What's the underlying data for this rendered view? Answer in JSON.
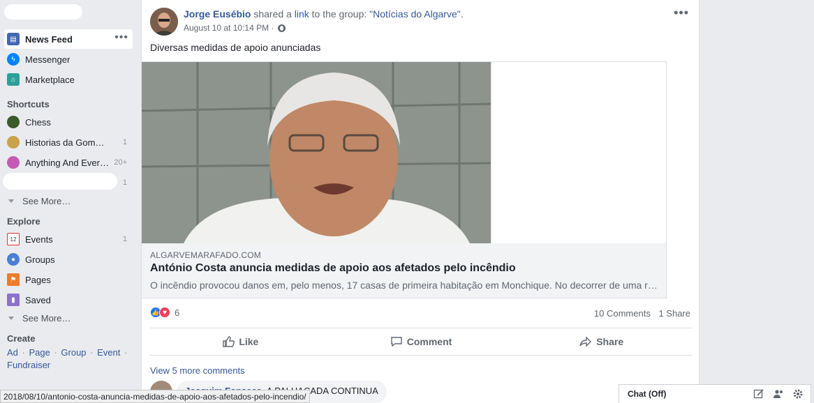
{
  "sidebar": {
    "main": [
      {
        "label": "News Feed",
        "icon": "news-feed-icon",
        "color": "#4267b2"
      },
      {
        "label": "Messenger",
        "icon": "messenger-icon",
        "color": "#0084ff"
      },
      {
        "label": "Marketplace",
        "icon": "marketplace-icon",
        "color": "#2aa198"
      }
    ],
    "shortcuts_title": "Shortcuts",
    "shortcuts": [
      {
        "label": "Chess",
        "count": ""
      },
      {
        "label": "Historias da Gomei…",
        "count": "1"
      },
      {
        "label": "Anything And Ever…",
        "count": "20+"
      },
      {
        "label": "",
        "count": "1"
      }
    ],
    "see_more": "See More…",
    "explore_title": "Explore",
    "explore": [
      {
        "label": "Events",
        "count": "1",
        "icon": "calendar-icon"
      },
      {
        "label": "Groups",
        "count": "",
        "icon": "groups-icon"
      },
      {
        "label": "Pages",
        "count": "",
        "icon": "pages-flag-icon"
      },
      {
        "label": "Saved",
        "count": "",
        "icon": "saved-bookmark-icon"
      }
    ],
    "see_more_2": "See More…",
    "create_title": "Create",
    "create_links": [
      "Ad",
      "Page",
      "Group",
      "Event",
      "Fundraiser"
    ]
  },
  "post": {
    "author": "Jorge Eusébio",
    "action_pre": " shared a ",
    "action_link": "link",
    "action_post": " to the group: ",
    "group": "\"Notícias do Algarve\"",
    "period": ".",
    "time": "August 10 at 10:14 PM · ",
    "text": "Diversas medidas de apoio anunciadas",
    "link_domain": "ALGARVEMARAFADO.COM",
    "link_title": "António Costa anuncia medidas de apoio aos afetados pelo incêndio",
    "link_desc": "O incêndio provocou danos em, pelo menos, 17 casas de primeira habitação em Monchique. No decorrer de uma reunião…",
    "reaction_count": "6",
    "comments_count": "10 Comments",
    "shares_count": "1 Share",
    "actions": {
      "like": "Like",
      "comment": "Comment",
      "share": "Share"
    },
    "view_more": "View 5 more comments",
    "comment": {
      "author": "Joaquim Fonseca",
      "text": "A PALHAÇADA CONTINUA"
    }
  },
  "status_url": "2018/08/10/antonio-costa-anuncia-medidas-de-apoio-aos-afetados-pelo-incendio/",
  "chat": {
    "title": "Chat (Off)"
  }
}
